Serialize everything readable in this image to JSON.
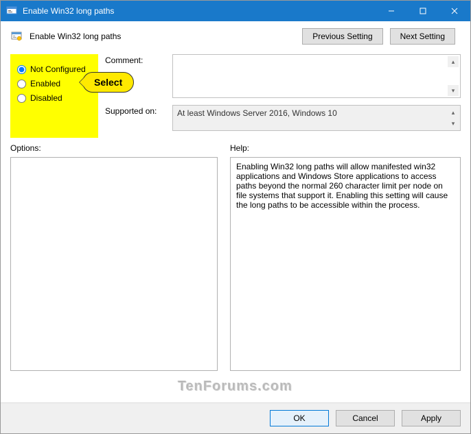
{
  "titlebar": {
    "text": "Enable Win32 long paths"
  },
  "header": {
    "policy_title": "Enable Win32 long paths",
    "previous_btn": "Previous Setting",
    "next_btn": "Next Setting"
  },
  "radios": {
    "not_configured": "Not Configured",
    "enabled": "Enabled",
    "disabled": "Disabled"
  },
  "labels": {
    "comment": "Comment:",
    "supported": "Supported on:",
    "options": "Options:",
    "help": "Help:"
  },
  "values": {
    "comment": "",
    "supported": "At least Windows Server 2016, Windows 10",
    "help_text": "Enabling Win32 long paths will allow manifested win32 applications and Windows Store applications to access paths beyond the normal 260 character limit per node on file systems that support it.  Enabling this setting will cause the long paths to be accessible within the process."
  },
  "footer": {
    "ok": "OK",
    "cancel": "Cancel",
    "apply": "Apply"
  },
  "annotation": {
    "callout": "Select",
    "watermark": "TenForums.com"
  }
}
